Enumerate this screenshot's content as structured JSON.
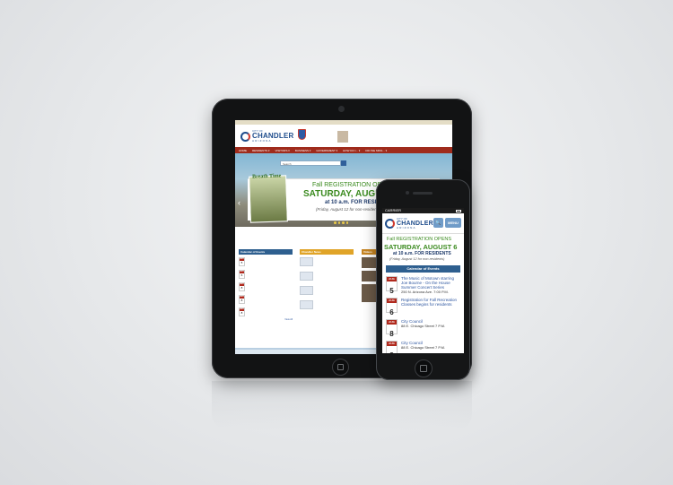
{
  "tablet": {
    "topbar_links": "",
    "logo": {
      "city": "CITY OF",
      "name": "CHANDLER",
      "state": "ARIZONA"
    },
    "header_promo": "",
    "nav": [
      "HOME",
      "RESIDENTS ▾",
      "VISITORS ▾",
      "BUSINESS ▾",
      "GOVERNMENT ▾",
      "HOW DO I... ▾",
      "DID WE MISS... ▾"
    ],
    "search_placeholder": "Search",
    "banner": {
      "left_title": "Breath Time",
      "reg_opens": "Fall REGISTRATION OPENS",
      "reg_date": "SATURDAY, AUGUST 6",
      "reg_time": "at 10 a.m. FOR RESIDENTS",
      "reg_friday": "(Friday, August 12 for non-residents)"
    },
    "columns": {
      "events_head": "Calendar of Events",
      "news_head": "Chandler News",
      "video_head": "Videos",
      "view_all": "View All"
    }
  },
  "phone": {
    "status_carrier": "CARRIER",
    "logo": {
      "city": "CITY OF",
      "name": "CHANDLER",
      "state": "ARIZONA"
    },
    "search_icon": "🔍",
    "menu_label": "MENU",
    "banner": {
      "reg_opens": "Fall REGISTRATION OPENS",
      "reg_date": "SATURDAY, AUGUST 6",
      "reg_time": "at 10 a.m. FOR RESIDENTS",
      "reg_friday": "(Friday, August 12 for non-residents)"
    },
    "calendar_head": "Calendar of Events",
    "events": [
      {
        "month": "AUG",
        "day": "5",
        "title": "The Music of Motown starring Joe Bourne - On the House Summer Concert Series",
        "location": "250 N. Arizona Ave. 7:00 P.M."
      },
      {
        "month": "AUG",
        "day": "6",
        "title": "Registration for Fall Recreation Classes begins for residents",
        "location": ""
      },
      {
        "month": "AUG",
        "day": "8",
        "title": "City Council",
        "location": "88 E. Chicago Street 7 P.M."
      },
      {
        "month": "AUG",
        "day": "8",
        "title": "City Council",
        "location": "88 E. Chicago Street 7 P.M."
      }
    ]
  },
  "colors": {
    "nav_red": "#9f2b1c",
    "brand_blue": "#1f4d8c",
    "promo_green": "#3a8a1e",
    "calendar_blue": "#2e5f8f"
  }
}
